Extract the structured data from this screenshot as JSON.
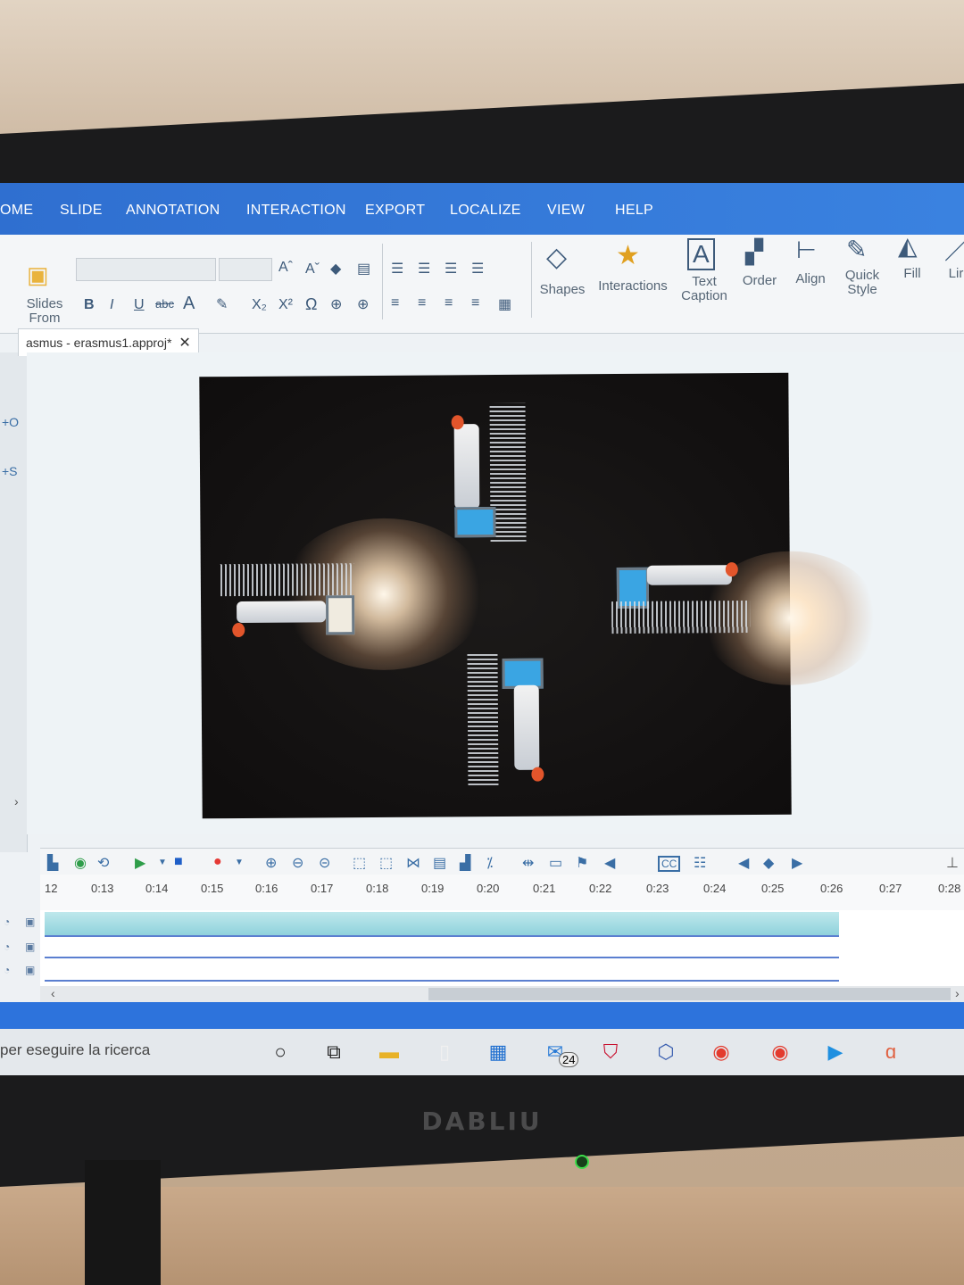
{
  "tabs": [
    "OME",
    "SLIDE",
    "ANNOTATION",
    "INTERACTION",
    "EXPORT",
    "LOCALIZE",
    "VIEW",
    "HELP"
  ],
  "ribbon": {
    "slides_from": "Slides From",
    "shapes": "Shapes",
    "interactions": "Interactions",
    "text_caption": "Text Caption",
    "order": "Order",
    "align": "Align",
    "quick_style": "Quick Style",
    "fill": "Fill",
    "line": "Lir",
    "font_buttons": [
      "B",
      "I",
      "U",
      "abc",
      "A",
      "X₂",
      "X²",
      "Ω"
    ]
  },
  "document": {
    "tab_title": "asmus - erasmus1.approj*",
    "close": "✕"
  },
  "left_panel": {
    "items": [
      "+O",
      "+S"
    ]
  },
  "timeline": {
    "ticks": [
      "12",
      "0:13",
      "0:14",
      "0:15",
      "0:16",
      "0:17",
      "0:18",
      "0:19",
      "0:20",
      "0:21",
      "0:22",
      "0:23",
      "0:24",
      "0:25",
      "0:26",
      "0:27",
      "0:28"
    ],
    "cc_label": "CC"
  },
  "taskbar": {
    "search_placeholder": "per eseguire la ricerca",
    "mail_badge": "24"
  },
  "monitor": {
    "brand": "DABLIU"
  },
  "colors": {
    "accent": "#2f6fd0",
    "film": "#3aa5e3",
    "record": "#e53935",
    "play": "#2e9d49"
  }
}
